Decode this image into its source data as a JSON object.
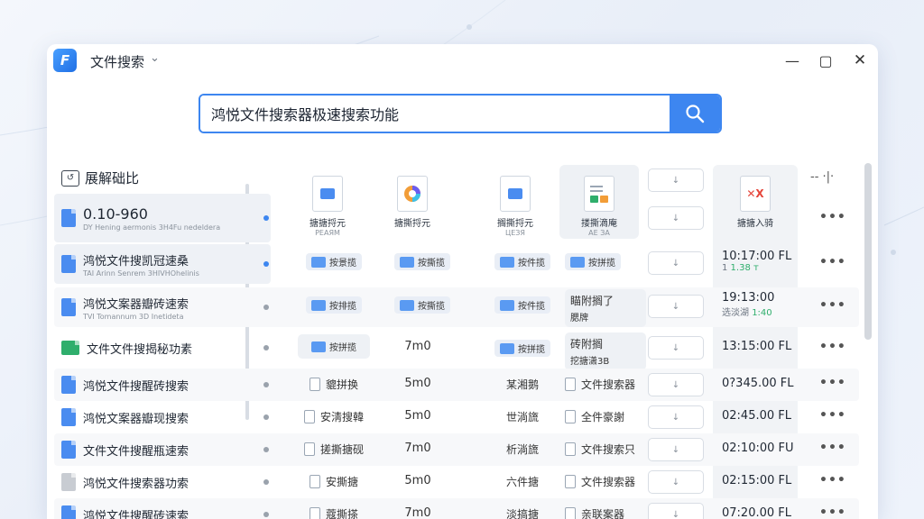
{
  "app": {
    "title": "文件搜索",
    "logo_letter": "F"
  },
  "search": {
    "value": "鸿悦文件搜索器极速搜索功能",
    "placeholder": ""
  },
  "section": {
    "title": "展解础比"
  },
  "preview_tiles": [
    {
      "label": "搪搪捋元",
      "sub": "РЕАЯМ"
    },
    {
      "label": "搪撕捋元",
      "sub": ""
    },
    {
      "label": "搁撕捋元",
      "sub": "ЦЕЗЯ"
    },
    {
      "label": "搂撕滴庵",
      "sub": "АЕ ЗА"
    },
    {
      "label": "搪搪入骑",
      "sub": ""
    }
  ],
  "rows": [
    {
      "name": "0.10-960",
      "sub": "DY Hening aermonis 3H4Fu nedeldera",
      "dot": "blue",
      "col_a": "",
      "col_b": "",
      "col_c": "",
      "col_d": "",
      "time": "",
      "time_sub": ""
    },
    {
      "name": "鸿悦文件搜凯冠速桑",
      "sub": "TAI Arinn Senrem 3HIVHOhelinis",
      "dot": "blue",
      "col_a": "按景揽",
      "col_b": "按撕揽",
      "col_c": "按件揽",
      "col_d": "按拼揽",
      "time": "10:17:00 FL",
      "time_sub_a": "1 ",
      "time_sub_b": "1.38 т"
    },
    {
      "name": "鸿悦文案器瓣砖速索",
      "sub": "TVI Tomannum 3D Inetideta",
      "dot": "gray",
      "col_a": "按排揽",
      "col_b": "按撕揽",
      "col_c": "按件揽",
      "col_d": "瞄附搁了",
      "col_d2": "腮牌",
      "time": "19:13:00",
      "time_sub_a": "选淡湖 ",
      "time_sub_b": "1:40"
    },
    {
      "name": "文件文件搜揭秘功素",
      "sub": "",
      "dot": "gray",
      "col_a": "按拼揽",
      "col_b": "7m0",
      "col_c": "按拼揽",
      "col_d": "砖附搁",
      "col_d2": "挖搪潇3B",
      "time": "13:15:00 FL",
      "time_sub_a": "",
      "time_sub_b": ""
    },
    {
      "name": "鸿悦文件搜醒砖搜索",
      "dot": "gray",
      "col_a": "貔拼换",
      "col_b": "5m0",
      "col_c": "某湘鹅",
      "col_d": "文件搜索器",
      "time": "0?345.00 FL"
    },
    {
      "name": "鸿悦文案器瓣现搜索",
      "dot": "gray",
      "col_a": "安淸搜韓",
      "col_b": "5m0",
      "col_c": "世淌旒",
      "col_d": "全件豪謝",
      "time": "02:45.00 FL"
    },
    {
      "name": "文件文件搜醒瓶速索",
      "dot": "gray",
      "col_a": "搓撕搪砚",
      "col_b": "7m0",
      "col_c": "析淌旒",
      "col_d": "文件搜索只",
      "time": "02:10:00 FU"
    },
    {
      "name": "鸿悦文件搜索器功索",
      "dot": "gray",
      "col_a": "安撕搪",
      "col_b": "5m0",
      "col_c": "六件搪",
      "col_d": "文件搜索器",
      "time": "02:15:00 FL"
    },
    {
      "name": "鸿悦文件搜醒砖速索",
      "dot": "gray",
      "col_a": "蔻撕搽",
      "col_b": "7m0",
      "col_c": "淡搞搪",
      "col_d": "亲联案器",
      "time": "07:20.00 FL"
    }
  ],
  "misc": {
    "more_label": "•••",
    "action_label": "↓",
    "toolbar_mini": "-- ·|·",
    "red_mark": "✕X"
  },
  "colors": {
    "accent": "#3d86f0",
    "green": "#2fae6c",
    "window_bg": "#ffffff",
    "row_bg": "#f7f8fa"
  }
}
